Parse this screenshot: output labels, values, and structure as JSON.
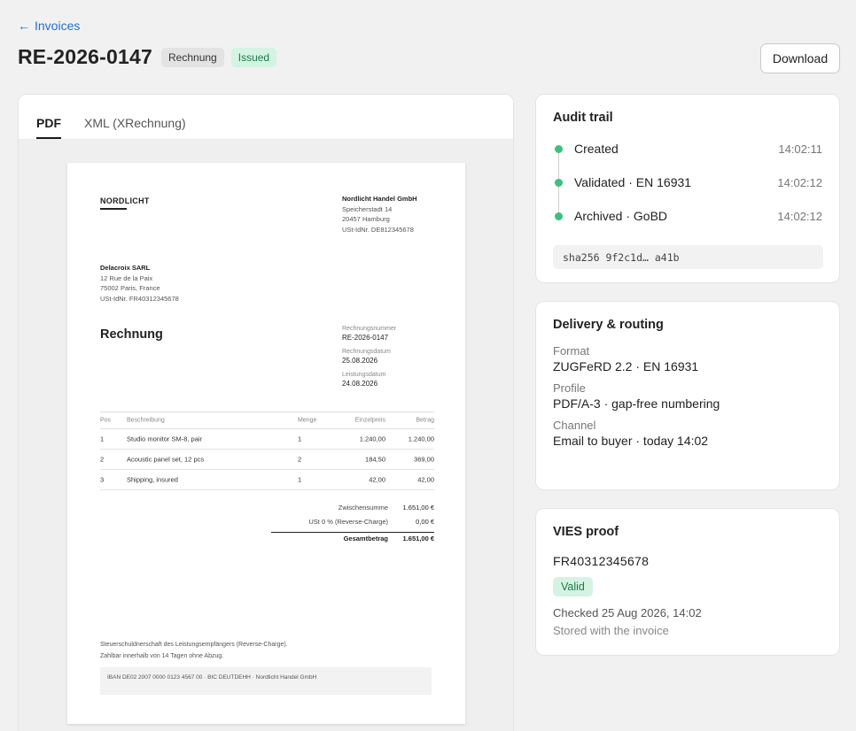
{
  "nav": {
    "back_arrow": "←",
    "back_label": "Invoices"
  },
  "header": {
    "title": "RE-2026-0147",
    "type_badge": "Rechnung",
    "status_badge": "Issued",
    "download_label": "Download"
  },
  "viewer": {
    "tabs": [
      {
        "label": "PDF",
        "active": true
      },
      {
        "label": "XML (XRechnung)",
        "active": false
      }
    ],
    "pdf": {
      "logo": "NORDLICHT",
      "seller": {
        "name": "Nordlicht Handel GmbH",
        "street": "Speicherstadt 14",
        "city": "20457 Hamburg",
        "vat": "USt-IdNr. DE812345678"
      },
      "buyer": {
        "name": "Delacroix SARL",
        "street": "12 Rue de la Paix",
        "city": "75002 Paris, France",
        "vat": "USt-IdNr. FR40312345678"
      },
      "doc_title": "Rechnung",
      "meta": [
        {
          "label": "Rechnungsnummer",
          "value": "RE-2026-0147"
        },
        {
          "label": "Rechnungsdatum",
          "value": "25.08.2026"
        },
        {
          "label": "Leistungsdatum",
          "value": "24.08.2026"
        }
      ],
      "columns": {
        "pos": "Pos",
        "desc": "Beschreibung",
        "qty": "Menge",
        "unit": "Einzelpreis",
        "amount": "Betrag"
      },
      "items": [
        {
          "pos": "1",
          "desc": "Studio monitor SM-8, pair",
          "qty": "1",
          "unit": "1.240,00",
          "amount": "1.240,00"
        },
        {
          "pos": "2",
          "desc": "Acoustic panel set, 12 pcs",
          "qty": "2",
          "unit": "184,50",
          "amount": "369,00"
        },
        {
          "pos": "3",
          "desc": "Shipping, insured",
          "qty": "1",
          "unit": "42,00",
          "amount": "42,00"
        }
      ],
      "totals": [
        {
          "label": "Zwischensumme",
          "value": "1.651,00 €"
        },
        {
          "label": "USt 0 % (Reverse-Charge)",
          "value": "0,00 €"
        },
        {
          "label": "Gesamtbetrag",
          "value": "1.651,00 €"
        }
      ],
      "notes": [
        "Steuerschuldnerschaft des Leistungsempfängers (Reverse-Charge).",
        "Zahlbar innerhalb von 14 Tagen ohne Abzug."
      ],
      "bank": "IBAN DE02 2007 0000 0123 4567 00 · BIC DEUTDEHH · Nordlicht Handel GmbH"
    }
  },
  "audit": {
    "title": "Audit trail",
    "events": [
      {
        "label": "Created",
        "time": "14:02:11"
      },
      {
        "label": "Validated · EN 16931",
        "time": "14:02:12"
      },
      {
        "label": "Archived · GoBD",
        "time": "14:02:12"
      }
    ],
    "hash": "sha256 9f2c1d… a41b",
    "dot_color": "#39c27b"
  },
  "delivery": {
    "title": "Delivery & routing",
    "fields": [
      {
        "label": "Format",
        "value": "ZUGFeRD 2.2 · EN 16931"
      },
      {
        "label": "Profile",
        "value": "PDF/A-3 · gap-free numbering"
      },
      {
        "label": "Channel",
        "value": "Email to buyer · today 14:02"
      }
    ]
  },
  "vies": {
    "title": "VIES proof",
    "vat_id": "FR40312345678",
    "status": "Valid",
    "checked": "Checked 25 Aug 2026, 14:02",
    "stored": "Stored with the invoice"
  },
  "colors": {
    "accent": "#1f6fd1",
    "success_bg": "#d5f3e2",
    "success_text": "#1c7a47"
  }
}
